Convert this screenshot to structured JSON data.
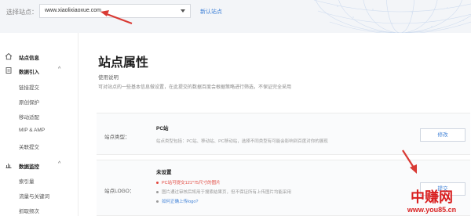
{
  "header": {
    "site_select_label": "选择站点：",
    "site_select_value": "www.xiaolixiaoxue.com",
    "add_site_label": "新认站点"
  },
  "sidebar": {
    "items": [
      {
        "label": "站点信息",
        "type": "head",
        "icon": "home-icon"
      },
      {
        "label": "数据引入",
        "type": "head",
        "icon": "import-icon"
      },
      {
        "label": "链接提交",
        "type": "item"
      },
      {
        "label": "原创保护",
        "type": "item"
      },
      {
        "label": "移动适配",
        "type": "item"
      },
      {
        "label": "MIP & AMP",
        "type": "item"
      },
      {
        "label": "关联提交",
        "type": "item"
      },
      {
        "label": "数据监控",
        "type": "head",
        "icon": "chart-icon"
      },
      {
        "label": "索引量",
        "type": "item"
      },
      {
        "label": "流量与关键词",
        "type": "item"
      },
      {
        "label": "抓取频次",
        "type": "item"
      }
    ]
  },
  "main": {
    "title": "站点属性",
    "usage_title": "使用说明",
    "usage_desc": "可对站点的一些基本信息做设置，在此提交的数据百度会根据策略进行筛选，不保证完全采用",
    "site_type": {
      "label": "站点类型：",
      "value": "PC站",
      "desc": "站点类型包括：PC站、移动站、PC移动站，选择不同类型有可能会影响到百度对你的展现",
      "button": "修改"
    },
    "site_logo": {
      "label": "站点LOGO：",
      "value": "未设置",
      "bullets": [
        "PC站可提交121*75尺寸的图片",
        "图片通过审核后将用于搜索结果页，但不保证所有上传图片均能采用",
        "如何正确上传logo?"
      ],
      "button": "提交"
    }
  },
  "watermark": {
    "title": "中赚网",
    "url": "www.you85.cn"
  },
  "colors": {
    "accent": "#3c7fd6",
    "warning": "#e2453c",
    "arrow": "#d93a34",
    "watermark": "#d92020"
  }
}
